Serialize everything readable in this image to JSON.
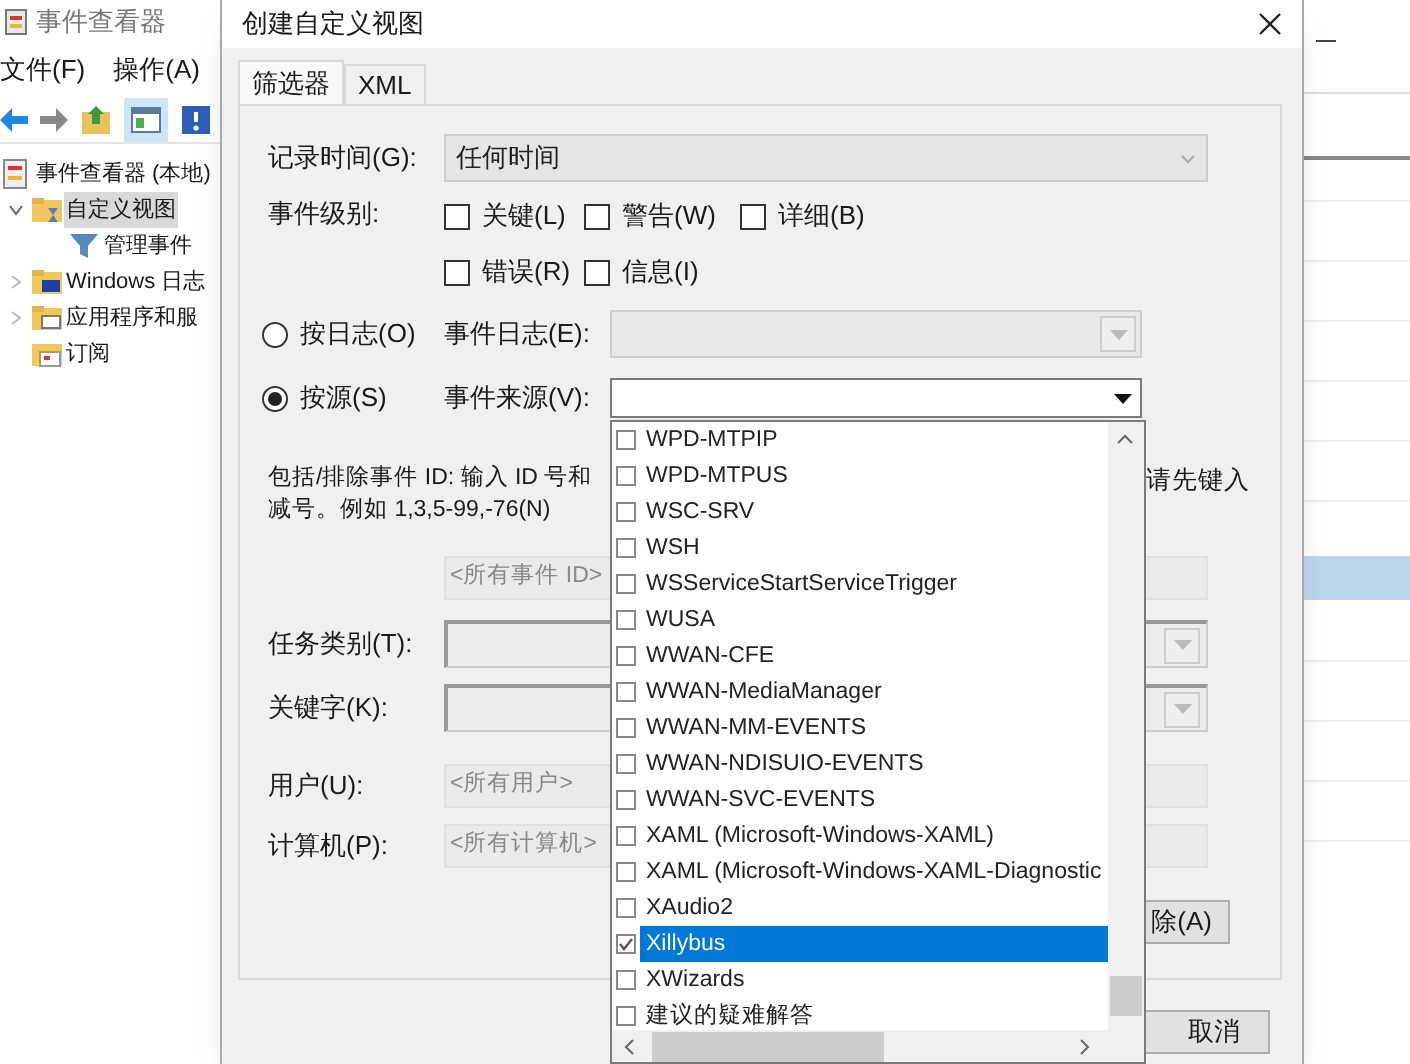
{
  "background_window": {
    "title": "事件查看器",
    "menu": [
      "文件(F)",
      "操作(A)"
    ],
    "tree": [
      {
        "label": "事件查看器 (本地)",
        "selected": false,
        "children": [
          {
            "label": "自定义视图",
            "selected": true,
            "expanded": true,
            "children": [
              {
                "label": "管理事件",
                "selected": false
              }
            ]
          },
          {
            "label": "Windows 日志",
            "selected": false,
            "expanded": false
          },
          {
            "label": "应用程序和服",
            "selected": false,
            "expanded": false
          },
          {
            "label": "订阅",
            "selected": false
          }
        ]
      }
    ]
  },
  "dialog": {
    "title": "创建自定义视图",
    "tabs": [
      {
        "label": "筛选器",
        "selected": true
      },
      {
        "label": "XML",
        "selected": false
      }
    ],
    "logged": {
      "label": "记录时间(G):",
      "value": "任何时间"
    },
    "event_level": {
      "label": "事件级别:",
      "options": [
        {
          "label": "关键(L)",
          "checked": false
        },
        {
          "label": "警告(W)",
          "checked": false
        },
        {
          "label": "详细(B)",
          "checked": false
        },
        {
          "label": "错误(R)",
          "checked": false
        },
        {
          "label": "信息(I)",
          "checked": false
        }
      ]
    },
    "scope": [
      {
        "label": "按日志(O)",
        "selected": false,
        "field_label": "事件日志(E):",
        "disabled": true
      },
      {
        "label": "按源(S)",
        "selected": true,
        "field_label": "事件来源(V):",
        "disabled": false
      }
    ],
    "source_list": [
      {
        "label": "WPD-MTPIP",
        "checked": false,
        "selected": false
      },
      {
        "label": "WPD-MTPUS",
        "checked": false,
        "selected": false
      },
      {
        "label": "WSC-SRV",
        "checked": false,
        "selected": false
      },
      {
        "label": "WSH",
        "checked": false,
        "selected": false
      },
      {
        "label": "WSServiceStartServiceTrigger",
        "checked": false,
        "selected": false
      },
      {
        "label": "WUSA",
        "checked": false,
        "selected": false
      },
      {
        "label": "WWAN-CFE",
        "checked": false,
        "selected": false
      },
      {
        "label": "WWAN-MediaManager",
        "checked": false,
        "selected": false
      },
      {
        "label": "WWAN-MM-EVENTS",
        "checked": false,
        "selected": false
      },
      {
        "label": "WWAN-NDISUIO-EVENTS",
        "checked": false,
        "selected": false
      },
      {
        "label": "WWAN-SVC-EVENTS",
        "checked": false,
        "selected": false
      },
      {
        "label": "XAML (Microsoft-Windows-XAML)",
        "checked": false,
        "selected": false
      },
      {
        "label": "XAML (Microsoft-Windows-XAML-Diagnostic",
        "checked": false,
        "selected": false
      },
      {
        "label": "XAudio2",
        "checked": false,
        "selected": false
      },
      {
        "label": "Xillybus",
        "checked": true,
        "selected": true
      },
      {
        "label": "XWizards",
        "checked": false,
        "selected": false
      },
      {
        "label": "建议的疑难解答",
        "checked": false,
        "selected": false
      }
    ],
    "description_lines": [
      "包括/排除事件 ID: 输入 ID 号和",
      "减号。例如 1,3,5-99,-76(N)"
    ],
    "description_right": "请先键入",
    "event_id": {
      "placeholder": "<所有事件 ID>"
    },
    "task_category": {
      "label": "任务类别(T):"
    },
    "keywords": {
      "label": "关键字(K):"
    },
    "user": {
      "label": "用户(U):",
      "placeholder": "<所有用户>"
    },
    "computer": {
      "label": "计算机(P):",
      "placeholder": "<所有计算机>"
    },
    "clear_button": "除(A)",
    "cancel_button": "取消"
  }
}
